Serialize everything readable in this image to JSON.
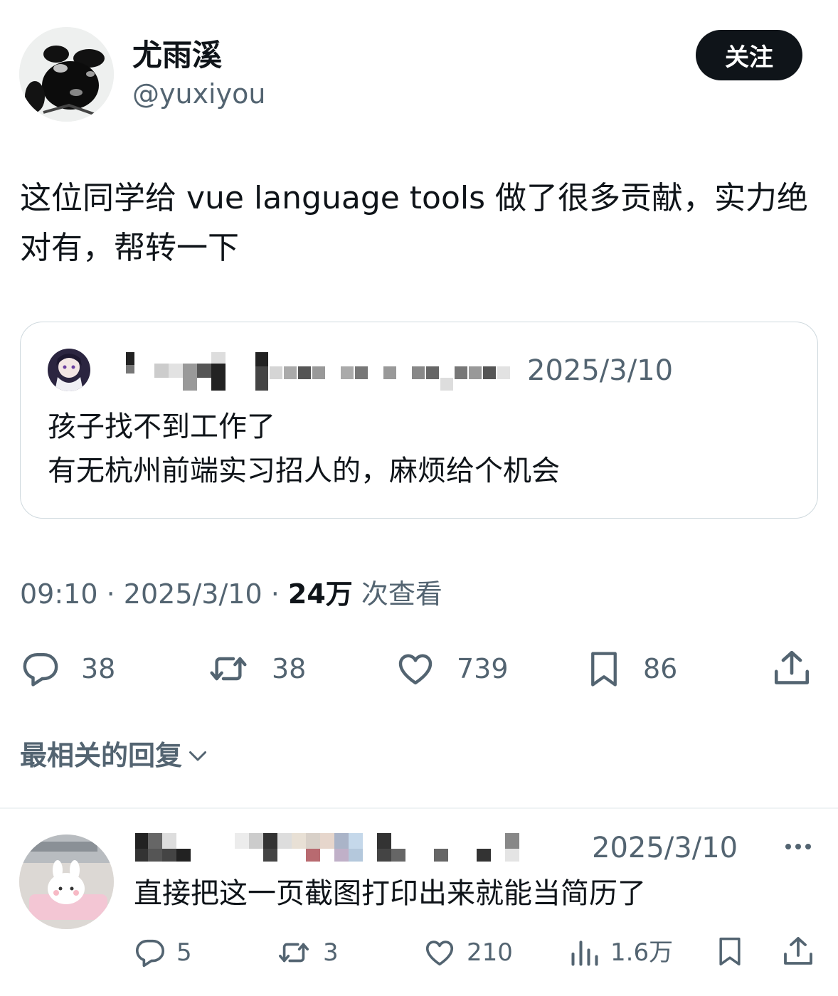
{
  "author": {
    "display_name": "尤雨溪",
    "handle": "@yuxiyou",
    "avatar_icon": "black-figure-avatar"
  },
  "follow_label": "关注",
  "tweet_text": "这位同学给 vue language tools 做了很多贡献，实力绝对有，帮转一下",
  "quote": {
    "name_obscured": true,
    "date": "2025/3/10",
    "lines": [
      "孩子找不到工作了",
      "有无杭州前端实习招人的，麻烦给个机会"
    ],
    "avatar_icon": "anime-girl-avatar"
  },
  "meta": {
    "time": "09:10",
    "date": "2025/3/10",
    "views_count": "24万",
    "views_label": "次查看",
    "separator": "·"
  },
  "actions": {
    "replies": "38",
    "retweets": "38",
    "likes": "739",
    "bookmarks": "86"
  },
  "replies_header": "最相关的回复",
  "reply": {
    "name_obscured": true,
    "date": "2025/3/10",
    "text": "直接把这一页截图打印出来就能当简历了",
    "avatar_icon": "bunny-sticker-avatar",
    "actions": {
      "replies": "5",
      "retweets": "3",
      "likes": "210",
      "views": "1.6万"
    }
  },
  "colors": {
    "text_primary": "#0f1419",
    "text_secondary": "#536471",
    "border": "#cfd9de",
    "button_bg": "#0f1419"
  }
}
